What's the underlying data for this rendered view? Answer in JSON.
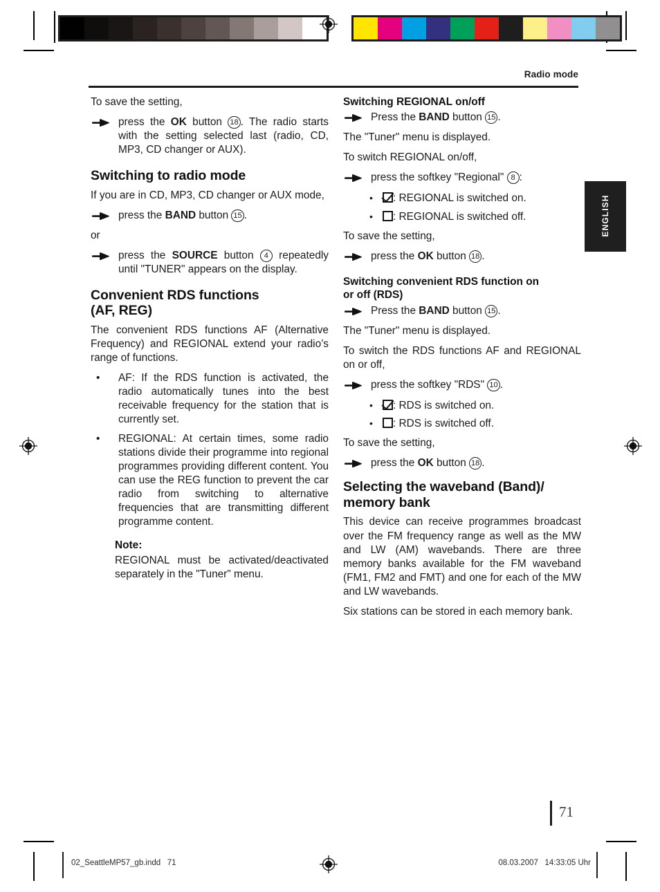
{
  "header": {
    "section_title": "Radio mode"
  },
  "thumb_tab": {
    "label": "ENGLISH"
  },
  "page_number": "71",
  "footer": {
    "file_name": "02_SeattleMP57_gb.indd   71",
    "timestamp": "08.03.2007   14:33:05 Uhr"
  },
  "calibration": {
    "gray_wedge": [
      "#010101",
      "#100d0d",
      "#1b1616",
      "#2b2322",
      "#3a302e",
      "#4e4241",
      "#635755",
      "#847874",
      "#a99e9b",
      "#d2c7c5",
      "#ffffff"
    ],
    "color_bar": [
      "#ffe500",
      "#e5007d",
      "#00a0e3",
      "#33307f",
      "#00a05a",
      "#e32119",
      "#1f1d1d",
      "#fbf08a",
      "#f18fc4",
      "#80cdef",
      "#918f8f"
    ]
  },
  "left_column": {
    "intro_line": "To save the setting,",
    "step_ok": {
      "pre": "press the ",
      "bold": "OK",
      "mid": " button ",
      "ref": "18",
      "post": ". The radio starts with the setting selected last (radio, CD, MP3, CD changer or AUX)."
    },
    "heading_switch_radio": "Switching to radio mode",
    "para_if_you_are": "If you are in CD, MP3, CD changer or AUX mode,",
    "step_band": {
      "pre": "press the ",
      "bold": "BAND",
      "mid": " button ",
      "ref": "15",
      "post": "."
    },
    "or_line": "or",
    "step_source": {
      "pre": "press the ",
      "bold": "SOURCE",
      "mid": " button ",
      "ref": "4",
      "post": " repeatedly until \"TUNER\" appears on the display."
    },
    "heading_rds_line1": "Convenient RDS functions",
    "heading_rds_line2": "(AF, REG)",
    "para_rds_intro": "The convenient RDS functions AF (Alternative Frequency) and REGIONAL extend your radio’s range of functions.",
    "bullet_af": "AF: If the RDS function is activated, the radio automatically tunes into the best receivable frequency for the station that is currently set.",
    "bullet_regional": "REGIONAL: At certain times, some radio stations divide their programme into regional programmes providing different content. You can use the REG function to prevent the car radio from switching to alternative frequencies that are transmitting different programme content.",
    "note_heading": "Note:",
    "note_body": "REGIONAL must be activated/deactivated separately in the \"Tuner\" menu."
  },
  "right_column": {
    "heading_switch_regional": "Switching REGIONAL on/off",
    "step_band_1": {
      "pre": "Press the ",
      "bold": "BAND",
      "mid": " button ",
      "ref": "15",
      "post": "."
    },
    "para_tuner_menu_1": "The \"Tuner\" menu is displayed.",
    "para_to_switch_regional": "To switch REGIONAL on/off,",
    "step_softkey_regional": {
      "pre": "press the softkey \"Regional\" ",
      "ref": "8",
      "post": ":"
    },
    "checked_regional_on": ": REGIONAL is switched on.",
    "unchecked_regional_off": ": REGIONAL is switched off.",
    "to_save_1": "To save the setting,",
    "step_ok_1": {
      "pre": "press the ",
      "bold": "OK",
      "mid": " button ",
      "ref": "18",
      "post": "."
    },
    "heading_rds_onoff_line1": "Switching convenient RDS function on",
    "heading_rds_onoff_line2": "or off (RDS)",
    "step_band_2": {
      "pre": "Press the ",
      "bold": "BAND",
      "mid": " button ",
      "ref": "15",
      "post": "."
    },
    "para_tuner_menu_2": "The \"Tuner\" menu is displayed.",
    "para_to_switch_rds": "To switch the RDS functions AF and REGIONAL on or off,",
    "step_softkey_rds": {
      "pre": "press the softkey \"RDS\" ",
      "ref": "10",
      "post": "."
    },
    "checked_rds_on": ": RDS is switched on.",
    "unchecked_rds_off": ": RDS is switched off.",
    "to_save_2": "To save the setting,",
    "step_ok_2": {
      "pre": "press the ",
      "bold": "OK",
      "mid": " button ",
      "ref": "18",
      "post": "."
    },
    "heading_waveband_line1": "Selecting the waveband (Band)/",
    "heading_waveband_line2": "memory bank",
    "para_waveband": "This device can receive programmes broadcast over the FM frequency range as well as the MW and LW (AM) wavebands. There are three memory banks available for the FM waveband (FM1, FM2 and FMT) and one for each of the MW and LW wavebands.",
    "para_six_stations": "Six stations can be stored in each memory bank."
  }
}
